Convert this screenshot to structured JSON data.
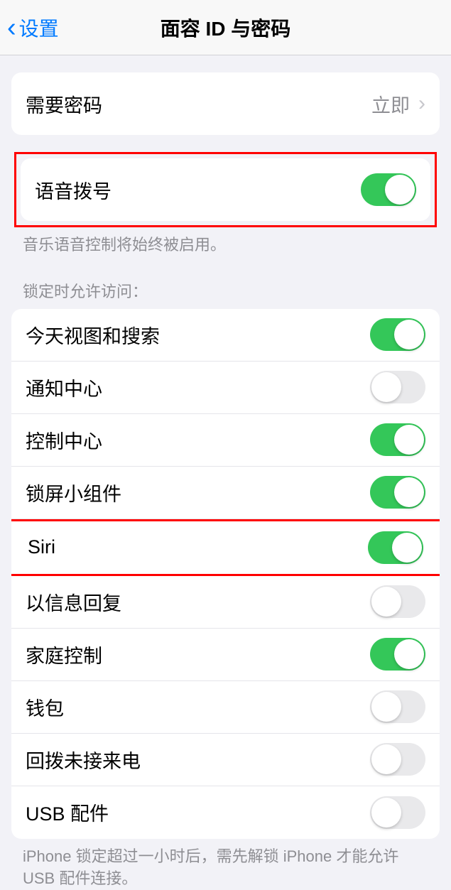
{
  "nav": {
    "back_label": "设置",
    "title": "面容 ID 与密码"
  },
  "passcode_row": {
    "label": "需要密码",
    "value": "立即"
  },
  "voice_dial": {
    "label": "语音拨号",
    "on": true,
    "footer": "音乐语音控制将始终被启用。"
  },
  "locked_section": {
    "header": "锁定时允许访问：",
    "items": [
      {
        "label": "今天视图和搜索",
        "on": true
      },
      {
        "label": "通知中心",
        "on": false
      },
      {
        "label": "控制中心",
        "on": true
      },
      {
        "label": "锁屏小组件",
        "on": true
      },
      {
        "label": "Siri",
        "on": true,
        "highlighted": true
      },
      {
        "label": "以信息回复",
        "on": false
      },
      {
        "label": "家庭控制",
        "on": true
      },
      {
        "label": "钱包",
        "on": false
      },
      {
        "label": "回拨未接来电",
        "on": false
      },
      {
        "label": "USB 配件",
        "on": false
      }
    ],
    "footer": "iPhone 锁定超过一小时后，需先解锁 iPhone 才能允许 USB 配件连接。"
  }
}
